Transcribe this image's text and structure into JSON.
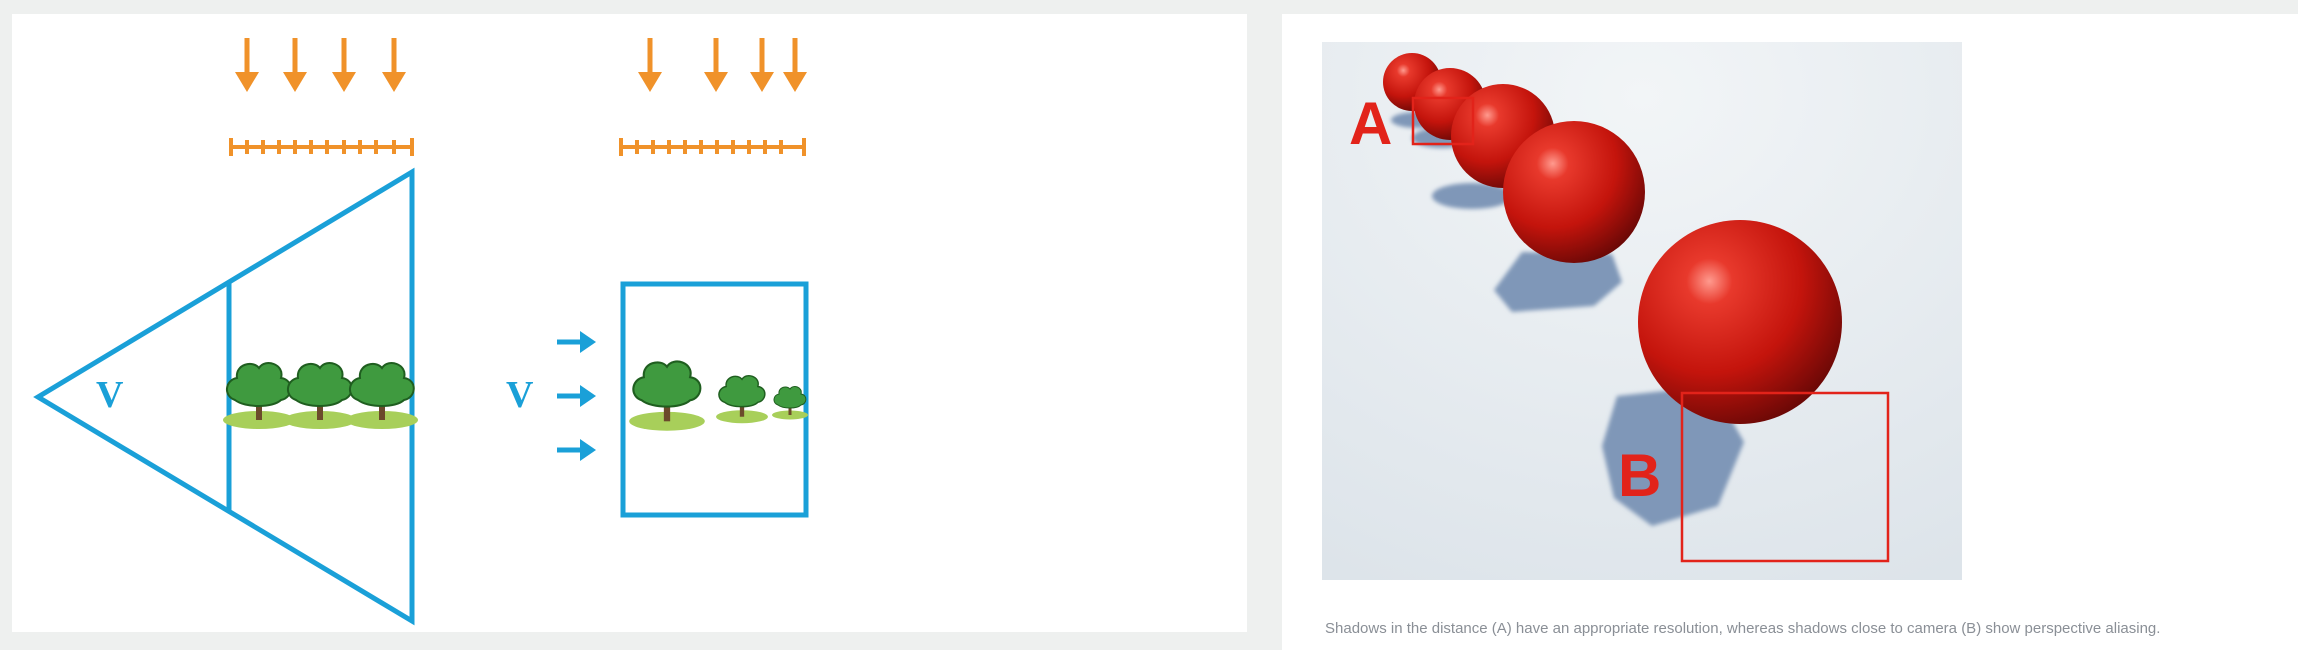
{
  "left_diagram": {
    "perspective_view_label": "V",
    "orthographic_view_label": "V"
  },
  "right_figure": {
    "label_a": "A",
    "label_b": "B",
    "caption": "Shadows in the distance (A) have an appropriate resolution, whereas shadows close to camera (B) show perspective aliasing."
  },
  "colors": {
    "frustum_blue": "#1aa0d8",
    "light_orange": "#f0922a",
    "tree_green": "#4caf50",
    "sphere_red": "#c8140c",
    "annotation_red": "#e2231a",
    "shadow_blue": "#7f97b8"
  }
}
